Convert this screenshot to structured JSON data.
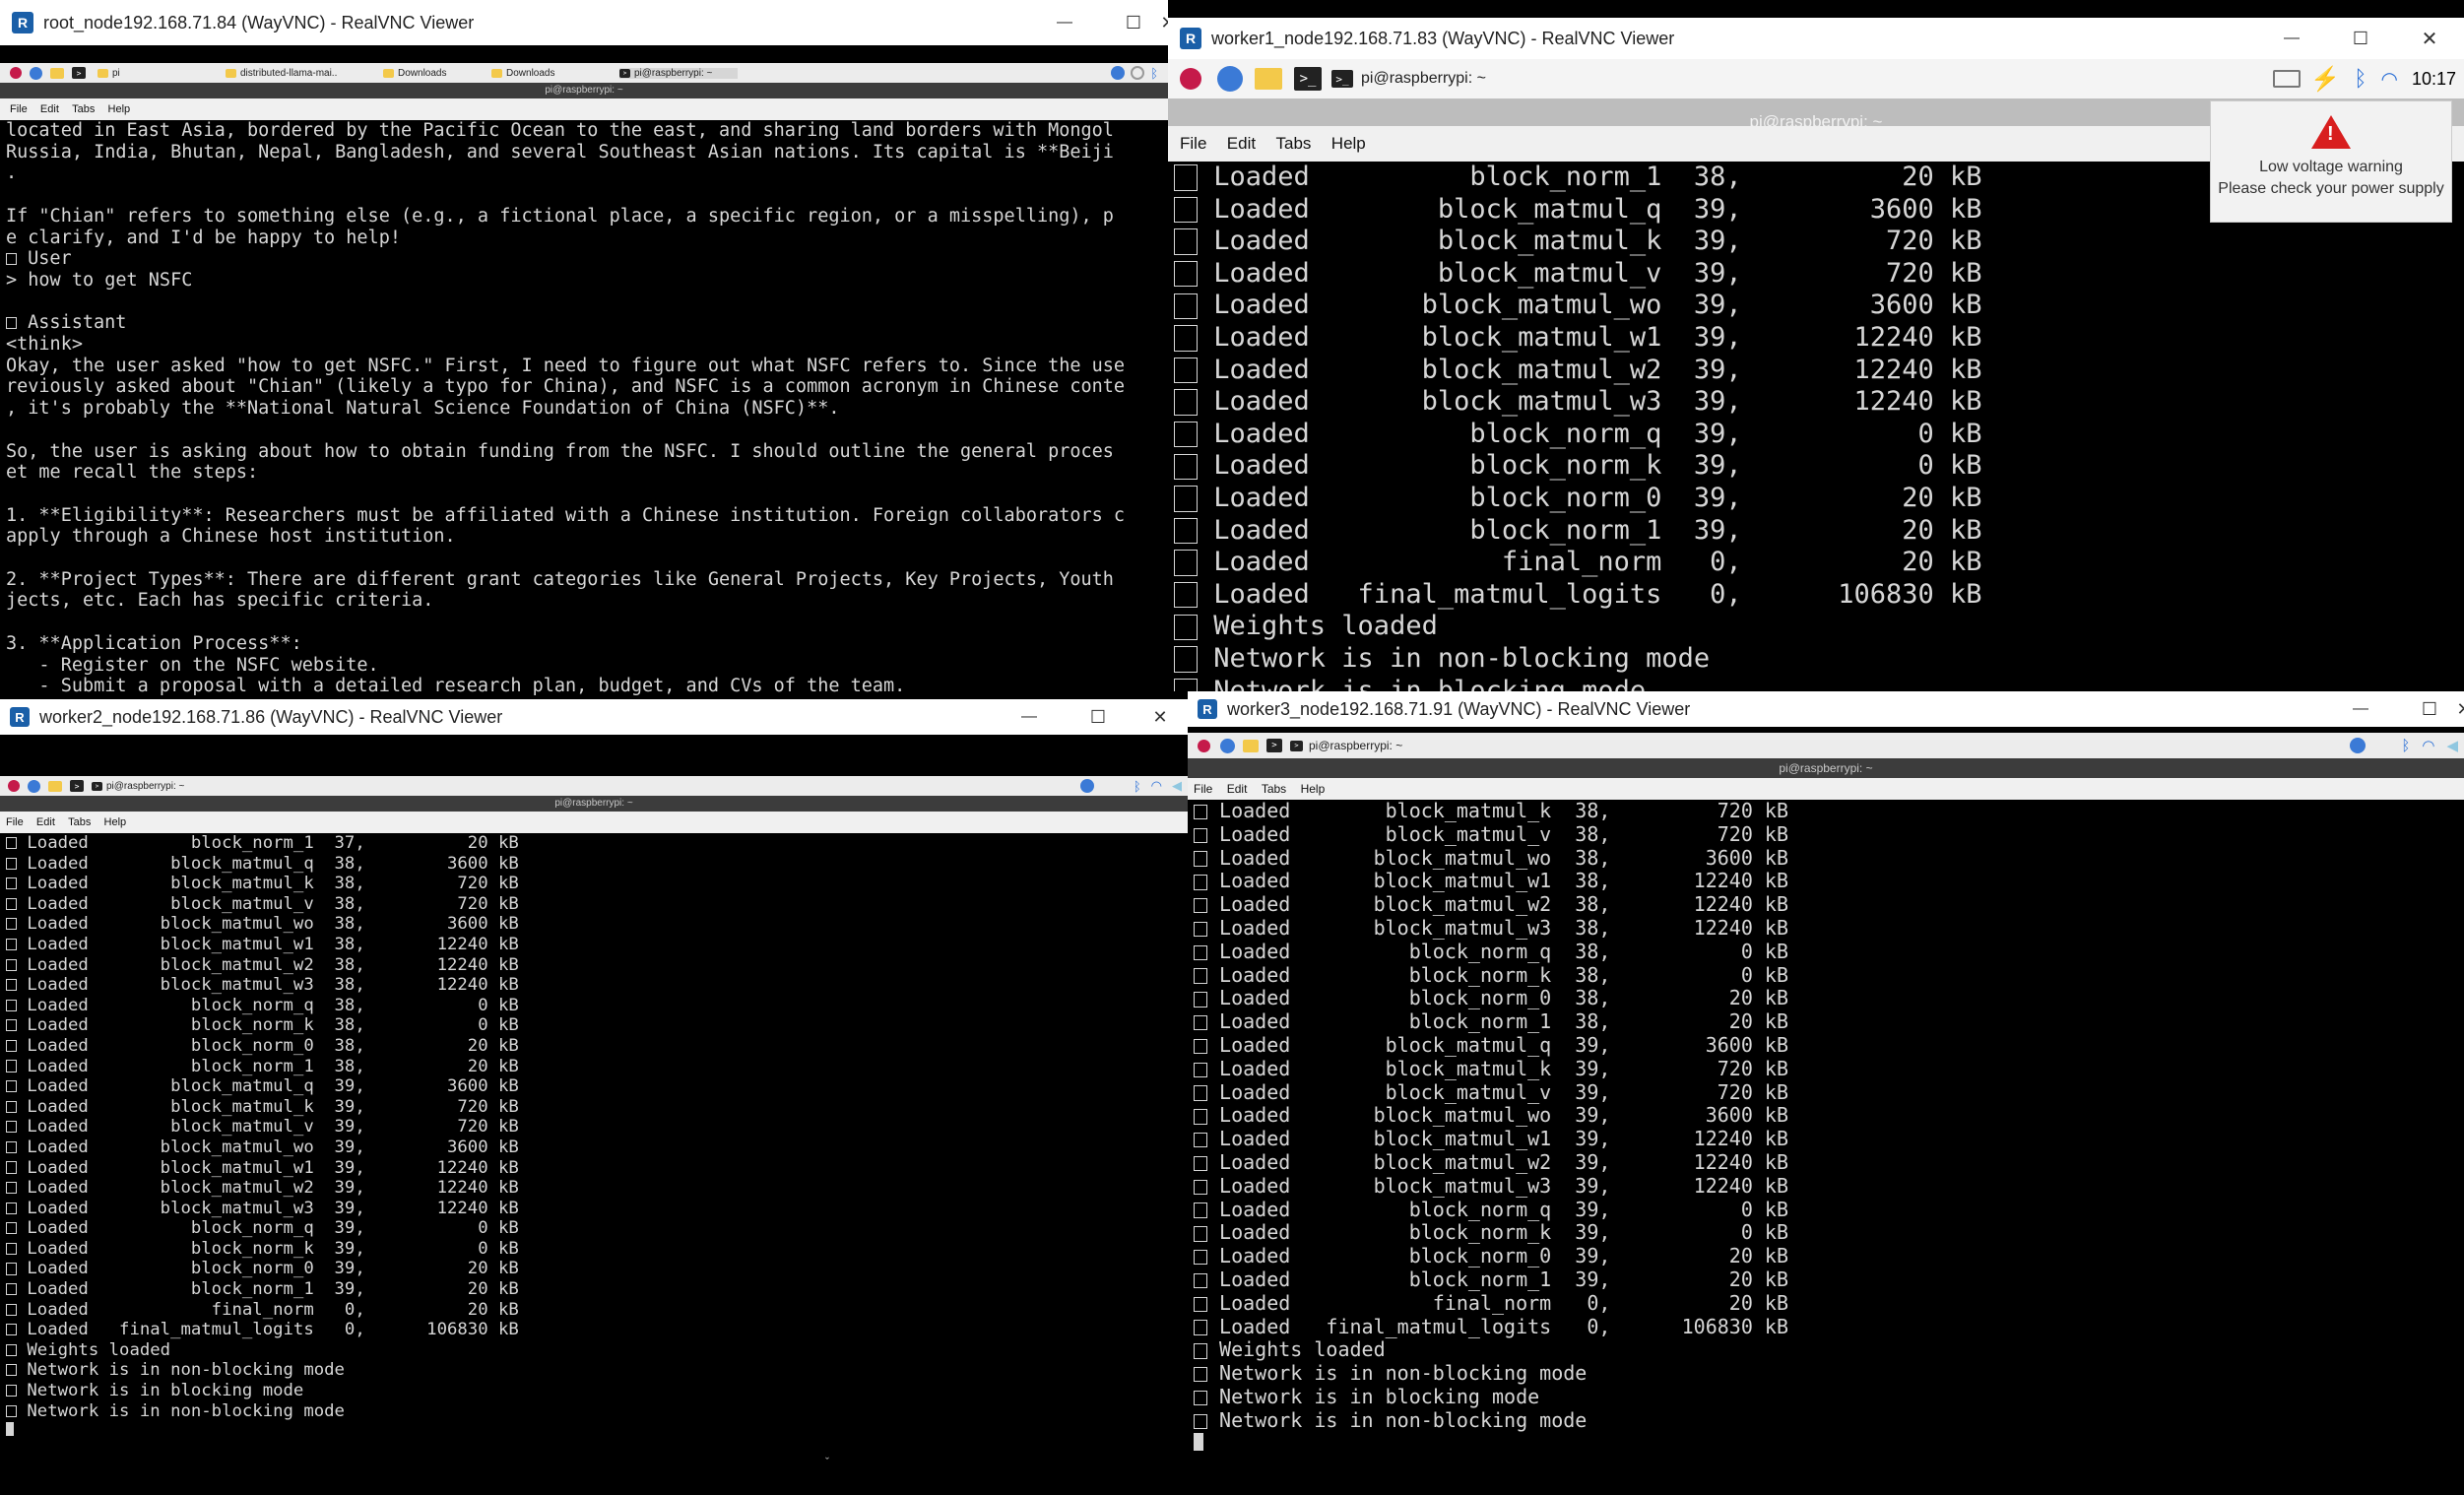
{
  "windows": {
    "root": {
      "title": "root_node192.168.71.84 (WayVNC) - RealVNC Viewer",
      "taskbar": [
        "pi",
        "distributed-llama-mai..",
        "Downloads",
        "Downloads",
        "pi@raspberrypi: ~"
      ],
      "terminal_title": "pi@raspberrypi: ~",
      "menu": [
        "File",
        "Edit",
        "Tabs",
        "Help"
      ],
      "lines": [
        "located in East Asia, bordered by the Pacific Ocean to the east, and sharing land borders with Mongol",
        "Russia, India, Bhutan, Nepal, Bangladesh, and several Southeast Asian nations. Its capital is **Beiji",
        ".",
        "",
        "If \"Chian\" refers to something else (e.g., a fictional place, a specific region, or a misspelling), p",
        "e clarify, and I'd be happy to help!",
        "\u0000 User",
        "> how to get NSFC",
        "",
        "\u0000 Assistant",
        "<think>",
        "Okay, the user asked \"how to get NSFC.\" First, I need to figure out what NSFC refers to. Since the use",
        "reviously asked about \"Chian\" (likely a typo for China), and NSFC is a common acronym in Chinese conte",
        ", it's probably the **National Natural Science Foundation of China (NSFC)**.",
        "",
        "So, the user is asking about how to obtain funding from the NSFC. I should outline the general proces",
        "et me recall the steps:",
        "",
        "1. **Eligibility**: Researchers must be affiliated with a Chinese institution. Foreign collaborators c",
        "apply through a Chinese host institution.",
        "",
        "2. **Project Types**: There are different grant categories like General Projects, Key Projects, Youth",
        "jects, etc. Each has specific criteria.",
        "",
        "3. **Application Process**:",
        "   - Register on the NSFC website.",
        "   - Submit a proposal with a detailed research plan, budget, and CVs of the team."
      ]
    },
    "worker1": {
      "title": "worker1_node192.168.71.83 (WayVNC) - RealVNC Viewer",
      "taskbar": [
        "pi@raspberrypi: ~"
      ],
      "clock": "10:17",
      "terminal_title": "pi@raspberrypi: ~",
      "menu": [
        "File",
        "Edit",
        "Tabs",
        "Help"
      ],
      "warning": {
        "line1": "Low voltage warning",
        "line2": "Please check your power supply"
      },
      "lines": [
        "\u0000 Loaded          block_norm_1  38,          20 kB",
        "\u0000 Loaded        block_matmul_q  39,        3600 kB",
        "\u0000 Loaded        block_matmul_k  39,         720 kB",
        "\u0000 Loaded        block_matmul_v  39,         720 kB",
        "\u0000 Loaded       block_matmul_wo  39,        3600 kB",
        "\u0000 Loaded       block_matmul_w1  39,       12240 kB",
        "\u0000 Loaded       block_matmul_w2  39,       12240 kB",
        "\u0000 Loaded       block_matmul_w3  39,       12240 kB",
        "\u0000 Loaded          block_norm_q  39,           0 kB",
        "\u0000 Loaded          block_norm_k  39,           0 kB",
        "\u0000 Loaded          block_norm_0  39,          20 kB",
        "\u0000 Loaded          block_norm_1  39,          20 kB",
        "\u0000 Loaded            final_norm   0,          20 kB",
        "\u0000 Loaded   final_matmul_logits   0,      106830 kB",
        "\u0000 Weights loaded",
        "\u0000 Network is in non-blocking mode",
        "\u0000 Network is in blocking mode"
      ]
    },
    "worker2": {
      "title": "worker2_node192.168.71.86 (WayVNC) - RealVNC Viewer",
      "taskbar": [
        "pi@raspberrypi: ~"
      ],
      "terminal_title": "pi@raspberrypi: ~",
      "menu": [
        "File",
        "Edit",
        "Tabs",
        "Help"
      ],
      "lines": [
        "\u0000 Loaded          block_norm_1  37,          20 kB",
        "\u0000 Loaded        block_matmul_q  38,        3600 kB",
        "\u0000 Loaded        block_matmul_k  38,         720 kB",
        "\u0000 Loaded        block_matmul_v  38,         720 kB",
        "\u0000 Loaded       block_matmul_wo  38,        3600 kB",
        "\u0000 Loaded       block_matmul_w1  38,       12240 kB",
        "\u0000 Loaded       block_matmul_w2  38,       12240 kB",
        "\u0000 Loaded       block_matmul_w3  38,       12240 kB",
        "\u0000 Loaded          block_norm_q  38,           0 kB",
        "\u0000 Loaded          block_norm_k  38,           0 kB",
        "\u0000 Loaded          block_norm_0  38,          20 kB",
        "\u0000 Loaded          block_norm_1  38,          20 kB",
        "\u0000 Loaded        block_matmul_q  39,        3600 kB",
        "\u0000 Loaded        block_matmul_k  39,         720 kB",
        "\u0000 Loaded        block_matmul_v  39,         720 kB",
        "\u0000 Loaded       block_matmul_wo  39,        3600 kB",
        "\u0000 Loaded       block_matmul_w1  39,       12240 kB",
        "\u0000 Loaded       block_matmul_w2  39,       12240 kB",
        "\u0000 Loaded       block_matmul_w3  39,       12240 kB",
        "\u0000 Loaded          block_norm_q  39,           0 kB",
        "\u0000 Loaded          block_norm_k  39,           0 kB",
        "\u0000 Loaded          block_norm_0  39,          20 kB",
        "\u0000 Loaded          block_norm_1  39,          20 kB",
        "\u0000 Loaded            final_norm   0,          20 kB",
        "\u0000 Loaded   final_matmul_logits   0,      106830 kB",
        "\u0000 Weights loaded",
        "\u0000 Network is in non-blocking mode",
        "\u0000 Network is in blocking mode",
        "\u0000 Network is in non-blocking mode"
      ]
    },
    "worker3": {
      "title": "worker3_node192.168.71.91 (WayVNC) - RealVNC Viewer",
      "taskbar": [
        "pi@raspberrypi: ~"
      ],
      "terminal_title": "pi@raspberrypi: ~",
      "menu": [
        "File",
        "Edit",
        "Tabs",
        "Help"
      ],
      "lines": [
        "\u0000 Loaded        block_matmul_k  38,         720 kB",
        "\u0000 Loaded        block_matmul_v  38,         720 kB",
        "\u0000 Loaded       block_matmul_wo  38,        3600 kB",
        "\u0000 Loaded       block_matmul_w1  38,       12240 kB",
        "\u0000 Loaded       block_matmul_w2  38,       12240 kB",
        "\u0000 Loaded       block_matmul_w3  38,       12240 kB",
        "\u0000 Loaded          block_norm_q  38,           0 kB",
        "\u0000 Loaded          block_norm_k  38,           0 kB",
        "\u0000 Loaded          block_norm_0  38,          20 kB",
        "\u0000 Loaded          block_norm_1  38,          20 kB",
        "\u0000 Loaded        block_matmul_q  39,        3600 kB",
        "\u0000 Loaded        block_matmul_k  39,         720 kB",
        "\u0000 Loaded        block_matmul_v  39,         720 kB",
        "\u0000 Loaded       block_matmul_wo  39,        3600 kB",
        "\u0000 Loaded       block_matmul_w1  39,       12240 kB",
        "\u0000 Loaded       block_matmul_w2  39,       12240 kB",
        "\u0000 Loaded       block_matmul_w3  39,       12240 kB",
        "\u0000 Loaded          block_norm_q  39,           0 kB",
        "\u0000 Loaded          block_norm_k  39,           0 kB",
        "\u0000 Loaded          block_norm_0  39,          20 kB",
        "\u0000 Loaded          block_norm_1  39,          20 kB",
        "\u0000 Loaded            final_norm   0,          20 kB",
        "\u0000 Loaded   final_matmul_logits   0,      106830 kB",
        "\u0000 Weights loaded",
        "\u0000 Network is in non-blocking mode",
        "\u0000 Network is in blocking mode",
        "\u0000 Network is in non-blocking mode"
      ]
    }
  },
  "controls": {
    "minimize": "—",
    "maximize": "☐",
    "close": "✕"
  },
  "colors": {
    "titlebar": "#ffffff",
    "terminal_bg": "#000000",
    "terminal_fg": "#d6d6d6",
    "vnc_logo": "#1a5fa8",
    "warning": "#d81e1e"
  }
}
